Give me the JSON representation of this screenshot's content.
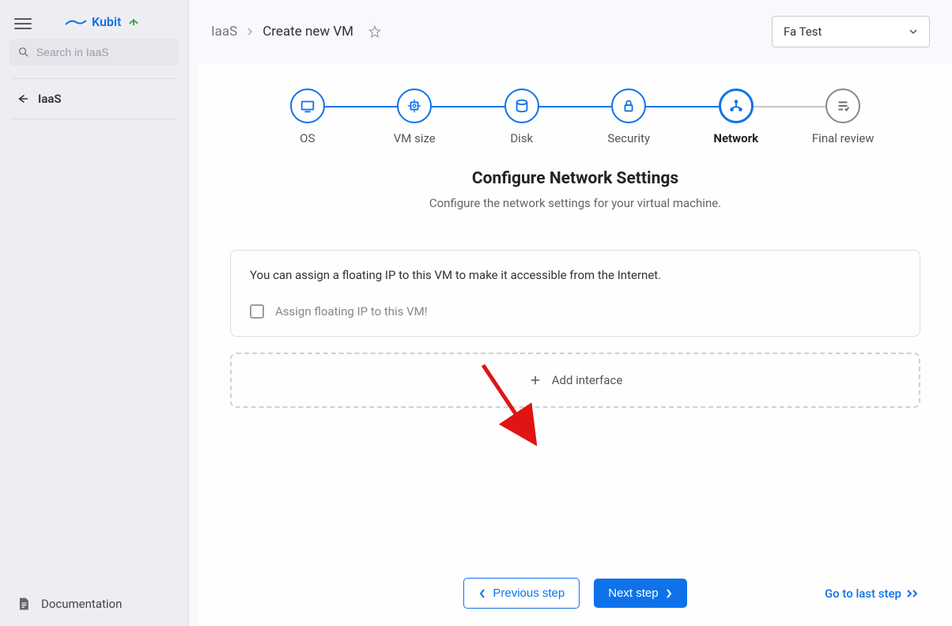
{
  "sidebar": {
    "logo_text": "Kubit",
    "search_placeholder": "Search in IaaS",
    "back_label": "IaaS",
    "documentation_label": "Documentation"
  },
  "breadcrumb": {
    "root": "IaaS",
    "current": "Create new VM"
  },
  "tenant": {
    "selected": "Fa Test"
  },
  "stepper": {
    "steps": [
      {
        "label": "OS",
        "active": true
      },
      {
        "label": "VM size",
        "active": true
      },
      {
        "label": "Disk",
        "active": true
      },
      {
        "label": "Security",
        "active": true
      },
      {
        "label": "Network",
        "active": true,
        "current": true
      },
      {
        "label": "Final review",
        "active": false
      }
    ]
  },
  "section": {
    "title": "Configure Network Settings",
    "description": "Configure the network settings for your virtual machine."
  },
  "card": {
    "info_text": "You can assign a floating IP to this VM to make it accessible from the Internet.",
    "checkbox_label": "Assign floating IP to this VM!"
  },
  "add_interface_label": "Add interface",
  "buttons": {
    "previous": "Previous step",
    "next": "Next step",
    "last": "Go to last step"
  }
}
